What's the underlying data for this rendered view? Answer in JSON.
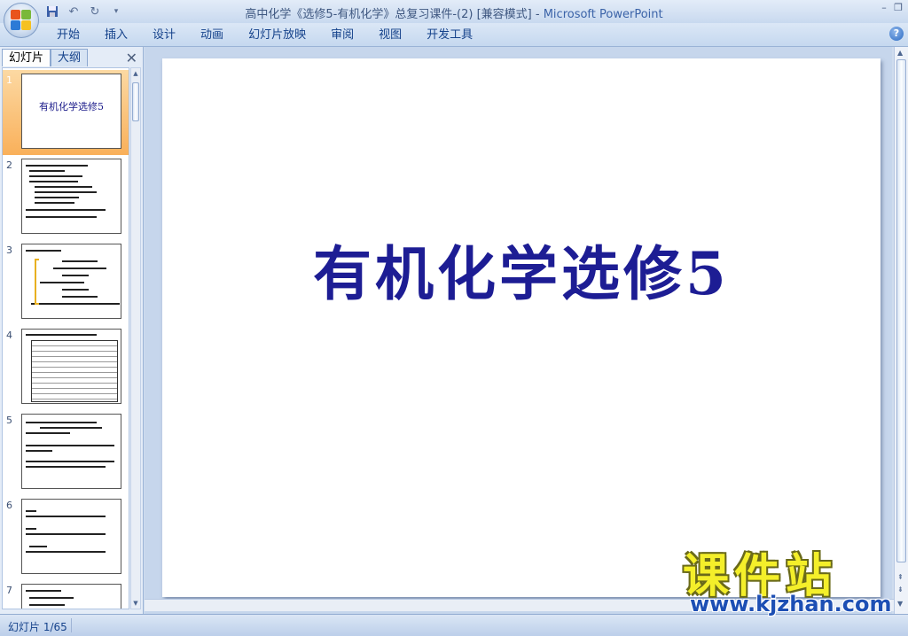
{
  "window": {
    "title_doc": "高中化学《选修5-有机化学》总复习课件-(2) [兼容模式]",
    "title_sep": " - ",
    "title_app": "Microsoft PowerPoint"
  },
  "ribbon": {
    "tabs": [
      "开始",
      "插入",
      "设计",
      "动画",
      "幻灯片放映",
      "审阅",
      "视图",
      "开发工具"
    ],
    "help": "?"
  },
  "leftpane": {
    "tabs": [
      "幻灯片",
      "大纲"
    ],
    "close": "✕",
    "thumbnails": [
      {
        "num": "1",
        "title": "有机化学选修5"
      },
      {
        "num": "2"
      },
      {
        "num": "3"
      },
      {
        "num": "4"
      },
      {
        "num": "5"
      },
      {
        "num": "6"
      },
      {
        "num": "7"
      }
    ]
  },
  "slide": {
    "title": "有机化学选修5"
  },
  "status": {
    "text": "幻灯片 1/65"
  },
  "watermark": {
    "brand": "课件站",
    "url": "www.kjzhan.com"
  },
  "colors": {
    "slide_title": "#1d1d94",
    "selected_thumb": "#f9b05a",
    "ribbon_text": "#15428b"
  },
  "icons": [
    "office-button-icon",
    "save-icon",
    "undo-icon",
    "redo-icon",
    "customize-qat-icon",
    "minimize-icon",
    "restore-icon",
    "help-icon",
    "close-pane-icon"
  ]
}
